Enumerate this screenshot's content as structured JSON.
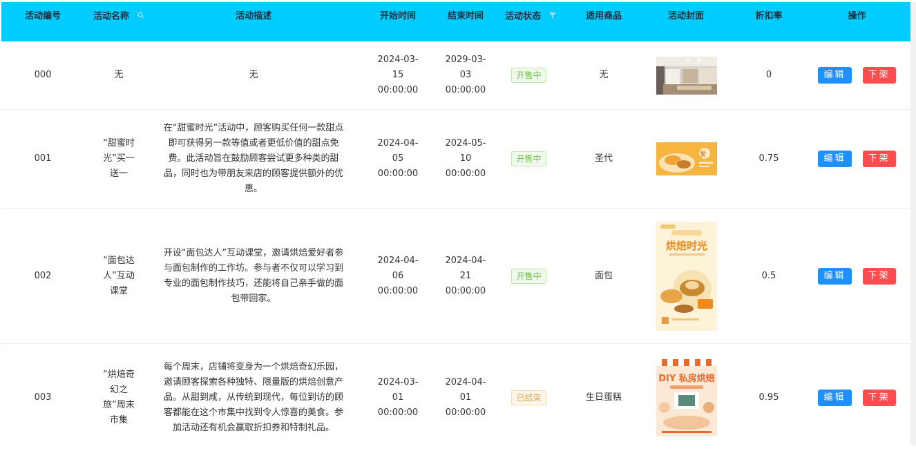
{
  "columns": {
    "id": "活动编号",
    "name": "活动名称",
    "desc": "活动描述",
    "start": "开始时间",
    "end": "结束时间",
    "status": "活动状态",
    "product": "适用商品",
    "cover": "活动封面",
    "discount": "折扣率",
    "ops": "操作"
  },
  "icons": {
    "name_header": "search-icon",
    "status_header": "filter-icon"
  },
  "colors": {
    "header_bg": "#00ccff",
    "status_on": "#67c23a",
    "status_off": "#e6a23c",
    "edit_button": "#1e90ff",
    "down_button": "#ff4d4f"
  },
  "actions": {
    "edit": "编辑",
    "down": "下架"
  },
  "rows": [
    {
      "id": "000",
      "name": [
        "无"
      ],
      "desc": [
        "无"
      ],
      "start": [
        "2024-03-",
        "15",
        "00:00:00"
      ],
      "end": [
        "2029-03-",
        "03",
        "00:00:00"
      ],
      "status": "开售中",
      "product": "无",
      "discount": "0",
      "cover": "store-interior-image"
    },
    {
      "id": "001",
      "name": [
        "“甜蜜时",
        "光”买一",
        "送一"
      ],
      "desc": [
        "在“甜蜜时光”活动中，顾客购买任何一款甜点",
        "即可获得另一款等值或者更低价值的甜点免",
        "费。此活动旨在鼓励顾客尝试更多种类的甜",
        "品，同时也为带朋友来店的顾客提供额外的优",
        "惠。"
      ],
      "start": [
        "2024-04-",
        "05",
        "00:00:00"
      ],
      "end": [
        "2024-05-",
        "10",
        "00:00:00"
      ],
      "status": "开售中",
      "product": "圣代",
      "discount": "0.75",
      "cover": "dessert-poster-image"
    },
    {
      "id": "002",
      "name": [
        "“面包达",
        "人”互动",
        "课堂"
      ],
      "desc": [
        "开设“面包达人”互动课堂，邀请烘焙爱好者参",
        "与面包制作的工作坊。参与者不仅可以学习到",
        "专业的面包制作技巧，还能将自己亲手做的面",
        "包带回家。"
      ],
      "start": [
        "2024-04-",
        "06",
        "00:00:00"
      ],
      "end": [
        "2024-04-",
        "21",
        "00:00:00"
      ],
      "status": "开售中",
      "product": "面包",
      "discount": "0.5",
      "cover": "baking-time-poster-image",
      "cover_text": "烘焙时光"
    },
    {
      "id": "003",
      "name": [
        "“烘焙奇",
        "幻之",
        "旅”周末",
        "市集"
      ],
      "desc": [
        "每个周末，店铺将变身为一个烘焙奇幻乐园，",
        "邀请顾客探索各种独特、限量版的烘焙创意产",
        "品。从甜到咸，从传统到现代，每位到访的顾",
        "客都能在这个市集中找到令人惊喜的美食。参",
        "加活动还有机会赢取折扣券和特制礼品。"
      ],
      "start": [
        "2024-03-",
        "01",
        "00:00:00"
      ],
      "end": [
        "2024-04-",
        "01",
        "00:00:00"
      ],
      "status": "已结束",
      "product": "生日蛋糕",
      "discount": "0.95",
      "cover": "diy-baking-poster-image",
      "cover_text": "DIY 私房烘焙"
    }
  ]
}
